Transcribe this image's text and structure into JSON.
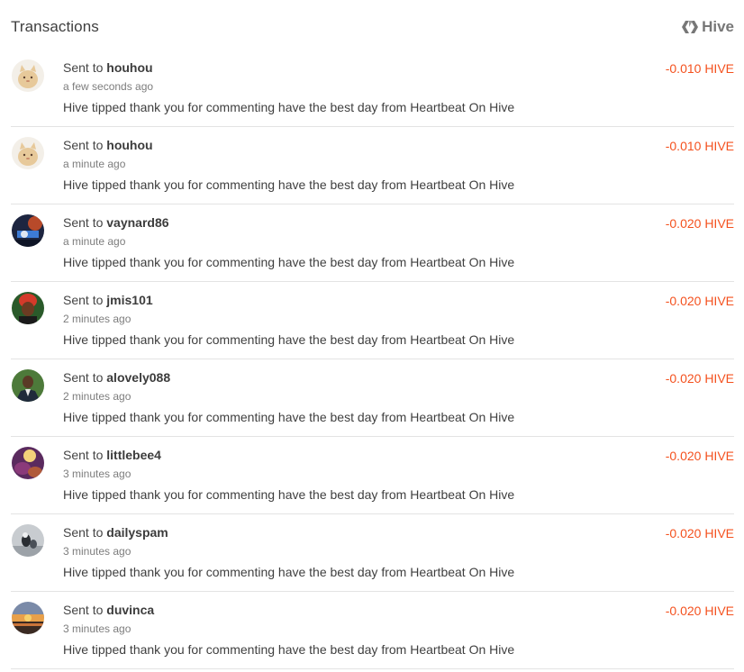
{
  "header": {
    "title": "Transactions",
    "brand_label": "Hive",
    "brand_icon": "hive-logo-icon",
    "brand_color": "#777777"
  },
  "accent_negative": "#f4511e",
  "transactions": [
    {
      "prefix": "Sent to",
      "user": "houhou",
      "time": "a few seconds ago",
      "memo": "Hive tipped thank you for commenting have the best day from Heartbeat On Hive",
      "amount": "-0.010 HIVE",
      "avatar": "cat-avatar"
    },
    {
      "prefix": "Sent to",
      "user": "houhou",
      "time": "a minute ago",
      "memo": "Hive tipped thank you for commenting have the best day from Heartbeat On Hive",
      "amount": "-0.010 HIVE",
      "avatar": "cat-avatar"
    },
    {
      "prefix": "Sent to",
      "user": "vaynard86",
      "time": "a minute ago",
      "memo": "Hive tipped thank you for commenting have the best day from Heartbeat On Hive",
      "amount": "-0.020 HIVE",
      "avatar": "game-avatar"
    },
    {
      "prefix": "Sent to",
      "user": "jmis101",
      "time": "2 minutes ago",
      "memo": "Hive tipped thank you for commenting have the best day from Heartbeat On Hive",
      "amount": "-0.020 HIVE",
      "avatar": "portrait-avatar"
    },
    {
      "prefix": "Sent to",
      "user": "alovely088",
      "time": "2 minutes ago",
      "memo": "Hive tipped thank you for commenting have the best day from Heartbeat On Hive",
      "amount": "-0.020 HIVE",
      "avatar": "suit-avatar"
    },
    {
      "prefix": "Sent to",
      "user": "littlebee4",
      "time": "3 minutes ago",
      "memo": "Hive tipped thank you for commenting have the best day from Heartbeat On Hive",
      "amount": "-0.020 HIVE",
      "avatar": "purple-avatar"
    },
    {
      "prefix": "Sent to",
      "user": "dailyspam",
      "time": "3 minutes ago",
      "memo": "Hive tipped thank you for commenting have the best day from Heartbeat On Hive",
      "amount": "-0.020 HIVE",
      "avatar": "mono-avatar"
    },
    {
      "prefix": "Sent to",
      "user": "duvinca",
      "time": "3 minutes ago",
      "memo": "Hive tipped thank you for commenting have the best day from Heartbeat On Hive",
      "amount": "-0.020 HIVE",
      "avatar": "sunset-avatar"
    }
  ]
}
